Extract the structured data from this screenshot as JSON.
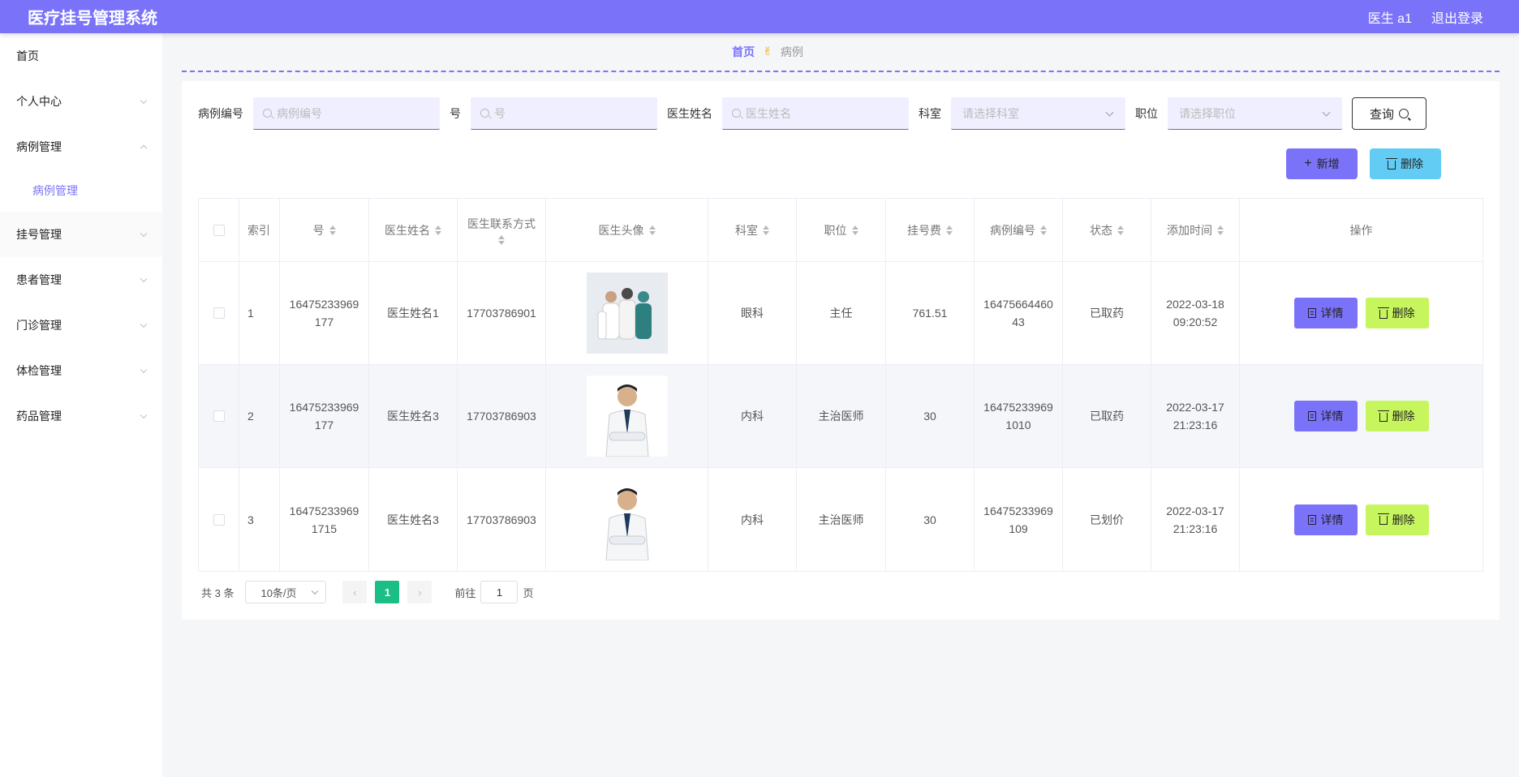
{
  "header": {
    "title": "医疗挂号管理系统",
    "user": "医生 a1",
    "logout": "退出登录"
  },
  "sidebar": {
    "items": [
      {
        "label": "首页"
      },
      {
        "label": "个人中心"
      },
      {
        "label": "病例管理"
      },
      {
        "label": "挂号管理"
      },
      {
        "label": "患者管理"
      },
      {
        "label": "门诊管理"
      },
      {
        "label": "体检管理"
      },
      {
        "label": "药品管理"
      }
    ],
    "sub_item": "病例管理"
  },
  "breadcrumb": {
    "home": "首页",
    "sep": "✌",
    "current": "病例"
  },
  "search": {
    "case_no_label": "病例编号",
    "case_no_placeholder": "病例编号",
    "no_label": "号",
    "no_placeholder": "号",
    "doctor_label": "医生姓名",
    "doctor_placeholder": "医生姓名",
    "dept_label": "科室",
    "dept_placeholder": "请选择科室",
    "position_label": "职位",
    "position_placeholder": "请选择职位",
    "query_button": "查询"
  },
  "actions": {
    "add": "新增",
    "delete": "删除"
  },
  "table": {
    "headers": [
      "索引",
      "号",
      "医生姓名",
      "医生联系方式",
      "医生头像",
      "科室",
      "职位",
      "挂号费",
      "病例编号",
      "状态",
      "添加时间",
      "操作"
    ],
    "rows": [
      {
        "index": "1",
        "no": "16475233969177",
        "doctor": "医生姓名1",
        "phone": "17703786901",
        "dept": "眼科",
        "position": "主任",
        "fee": "761.51",
        "case_no": "1647566446043",
        "status": "已取药",
        "time": "2022-03-18 09:20:52"
      },
      {
        "index": "2",
        "no": "16475233969177",
        "doctor": "医生姓名3",
        "phone": "17703786903",
        "dept": "内科",
        "position": "主治医师",
        "fee": "30",
        "case_no": "164752339691010",
        "status": "已取药",
        "time": "2022-03-17 21:23:16"
      },
      {
        "index": "3",
        "no": "164752339691715",
        "doctor": "医生姓名3",
        "phone": "17703786903",
        "dept": "内科",
        "position": "主治医师",
        "fee": "30",
        "case_no": "16475233969109",
        "status": "已划价",
        "time": "2022-03-17 21:23:16"
      }
    ],
    "detail_button": "详情",
    "delete_button": "删除"
  },
  "pager": {
    "total": "共 3 条",
    "page_size": "10条/页",
    "current": "1",
    "goto_label": "前往",
    "goto_value": "1",
    "page_unit": "页"
  },
  "colors": {
    "accent": "#7a73fa",
    "delete_light": "#62ccf5",
    "delete_row": "#c7f55e",
    "page_active": "#1bbf86"
  }
}
